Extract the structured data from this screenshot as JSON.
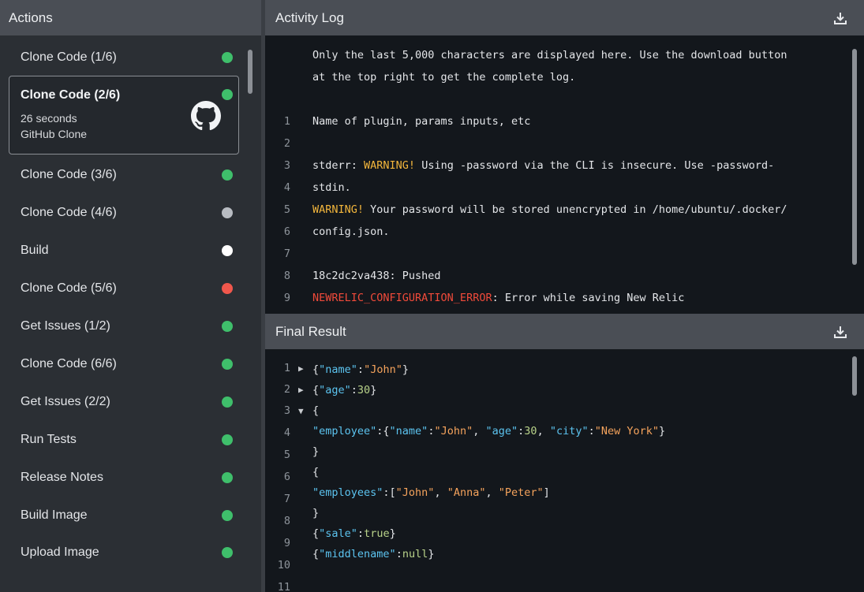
{
  "sidebar": {
    "title": "Actions",
    "items": [
      {
        "label": "Clone Code (1/6)",
        "status": "green"
      },
      {
        "label": "Clone Code (2/6)",
        "status": "green",
        "duration": "26 seconds",
        "type": "GitHub Clone"
      },
      {
        "label": "Clone Code (3/6)",
        "status": "green"
      },
      {
        "label": "Clone Code (4/6)",
        "status": "gray"
      },
      {
        "label": "Build",
        "status": "white"
      },
      {
        "label": "Clone Code (5/6)",
        "status": "red"
      },
      {
        "label": "Get Issues (1/2)",
        "status": "green"
      },
      {
        "label": "Clone Code (6/6)",
        "status": "green"
      },
      {
        "label": "Get Issues (2/2)",
        "status": "green"
      },
      {
        "label": "Run Tests",
        "status": "green"
      },
      {
        "label": "Release Notes",
        "status": "green"
      },
      {
        "label": "Build Image",
        "status": "green"
      },
      {
        "label": "Upload Image",
        "status": "green"
      }
    ]
  },
  "status_colors": {
    "green": "#3fbf6b",
    "gray": "#b8bcc2",
    "white": "#ffffff",
    "red": "#f0574c"
  },
  "activity_log": {
    "title": "Activity Log",
    "notice_1": "Only the last 5,000 characters are displayed here. Use the download button",
    "notice_2": "at the top right to get the complete log.",
    "lines": [
      {
        "n": "1",
        "text": "Name of plugin, params inputs, etc"
      },
      {
        "n": "2",
        "text": ""
      },
      {
        "n": "3",
        "prefix": "stderr: ",
        "warn": "WARNING!",
        "text": " Using -password via the CLI is insecure. Use -password-"
      },
      {
        "n": "4",
        "text": "stdin."
      },
      {
        "n": "5",
        "warn": "WARNING!",
        "text": " Your password will be stored unencrypted in /home/ubuntu/.docker/"
      },
      {
        "n": "6",
        "text": "config.json."
      },
      {
        "n": "7",
        "text": ""
      },
      {
        "n": "8",
        "text": "18c2dc2va438: Pushed"
      },
      {
        "n": "9",
        "err": "NEWRELIC_CONFIGURATION_ERROR",
        "text": ": Error while saving New Relic"
      }
    ]
  },
  "final_result": {
    "title": "Final Result",
    "line_numbers": [
      "1",
      "2",
      "3",
      "4",
      "5",
      "6",
      "7",
      "8",
      "9",
      "10",
      "11"
    ],
    "arrows": {
      "1": "▶",
      "2": "▶",
      "3": "▼"
    }
  }
}
